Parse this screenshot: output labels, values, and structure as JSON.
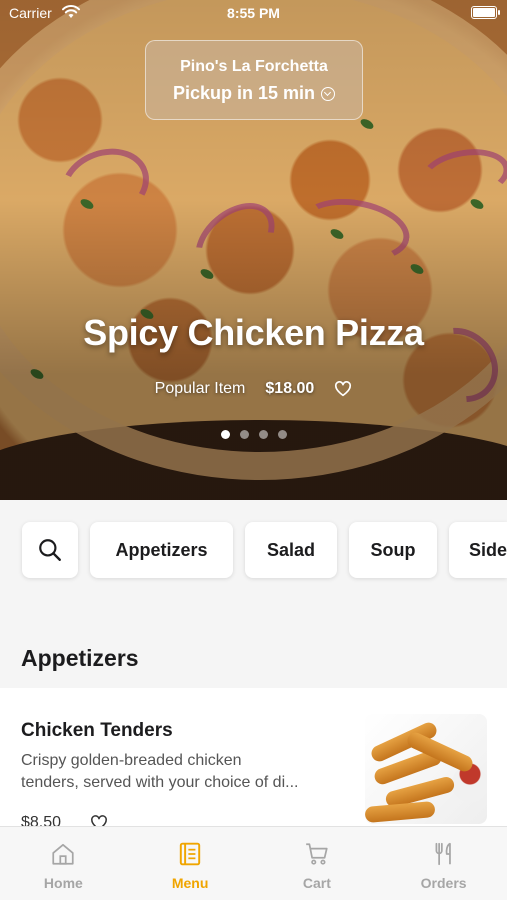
{
  "status_bar": {
    "carrier": "Carrier",
    "time": "8:55 PM"
  },
  "restaurant": {
    "name": "Pino's La Forchetta",
    "pickup": "Pickup in 15 min"
  },
  "hero": {
    "title": "Spicy Chicken Pizza",
    "tag": "Popular Item",
    "price": "$18.00",
    "page_count": 4,
    "active_page": 1
  },
  "categories": [
    "Appetizers",
    "Salad",
    "Soup",
    "Sides"
  ],
  "section": {
    "title": "Appetizers"
  },
  "items": [
    {
      "name": "Chicken Tenders",
      "desc_line1": "Crispy golden-breaded chicken",
      "desc_line2": "tenders, served with your choice of di...",
      "price": "$8.50"
    }
  ],
  "tabs": [
    {
      "label": "Home",
      "icon": "home-icon",
      "active": false
    },
    {
      "label": "Menu",
      "icon": "menu-icon",
      "active": true
    },
    {
      "label": "Cart",
      "icon": "cart-icon",
      "active": false
    },
    {
      "label": "Orders",
      "icon": "orders-icon",
      "active": false
    }
  ],
  "colors": {
    "accent": "#f0a500",
    "inactive": "#a6a6a6"
  }
}
